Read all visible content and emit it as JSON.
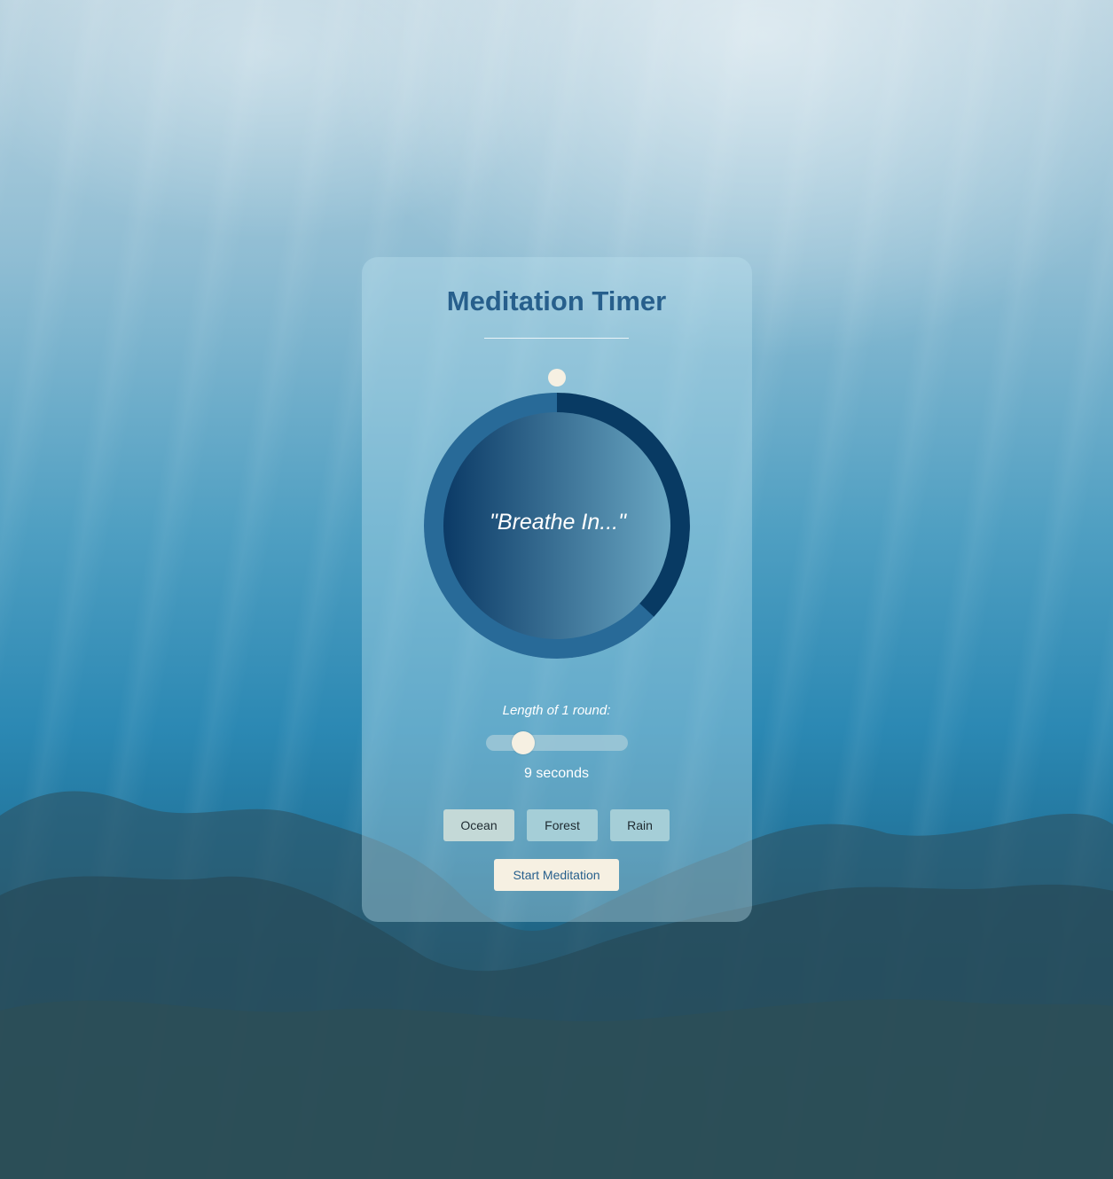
{
  "app": {
    "title": "Meditation Timer"
  },
  "timer": {
    "phrase": "\"Breathe In...\"",
    "progress_fraction": 0.37
  },
  "round_length": {
    "label": "Length of 1 round:",
    "value_seconds": 9,
    "slider_fraction": 0.22,
    "value_text": "9 seconds"
  },
  "sounds": [
    {
      "label": "Ocean",
      "selected": true
    },
    {
      "label": "Forest",
      "selected": false
    },
    {
      "label": "Rain",
      "selected": false
    }
  ],
  "actions": {
    "start_label": "Start Meditation"
  },
  "colors": {
    "title": "#275f8c",
    "progress_arc": "#083a63",
    "ring_outer": "#286a98",
    "ring_track": "#b6dceb",
    "accent_cream": "#f6f0e2"
  }
}
